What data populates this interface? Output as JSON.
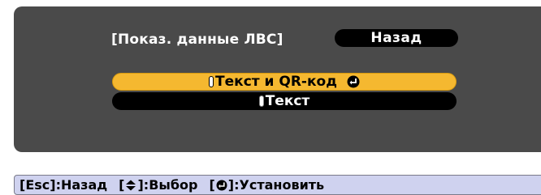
{
  "menu": {
    "title": "[Показ. данные ЛВС]",
    "back_label": "Назад",
    "options": [
      {
        "label": "Текст и QR-код",
        "selected": true
      },
      {
        "label": "Текст",
        "selected": false
      }
    ]
  },
  "status_bar": {
    "hints": [
      {
        "key_prefix": "[Esc]",
        "action": ":Назад"
      },
      {
        "key_prefix": "[",
        "icon": "up-down-arrow-icon",
        "key_suffix": "]",
        "action": ":Выбор"
      },
      {
        "key_prefix": "[",
        "icon": "enter-icon",
        "key_suffix": "]",
        "action": ":Установить"
      }
    ]
  },
  "colors": {
    "panel": "#4a4a4a",
    "highlight": "#f5b830",
    "status_bar": "#cfd2ef"
  }
}
